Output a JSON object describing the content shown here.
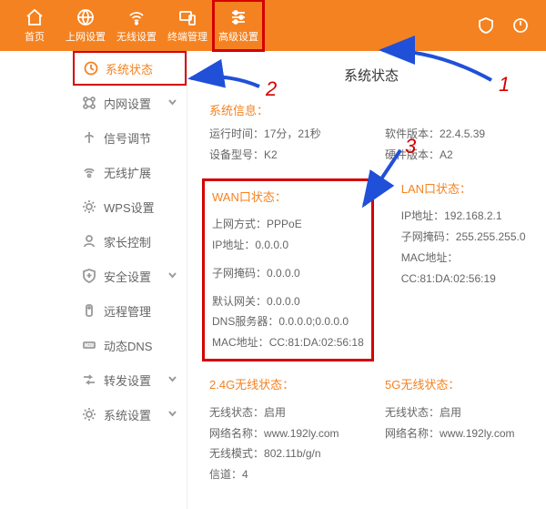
{
  "topnav": {
    "items": [
      {
        "label": "首页"
      },
      {
        "label": "上网设置"
      },
      {
        "label": "无线设置"
      },
      {
        "label": "终端管理"
      },
      {
        "label": "高级设置"
      }
    ]
  },
  "sidebar": {
    "items": [
      {
        "label": "系统状态"
      },
      {
        "label": "内网设置"
      },
      {
        "label": "信号调节"
      },
      {
        "label": "无线扩展"
      },
      {
        "label": "WPS设置"
      },
      {
        "label": "家长控制"
      },
      {
        "label": "安全设置"
      },
      {
        "label": "远程管理"
      },
      {
        "label": "动态DNS"
      },
      {
        "label": "转发设置"
      },
      {
        "label": "系统设置"
      }
    ]
  },
  "page": {
    "title": "系统状态"
  },
  "sysinfo": {
    "head": "系统信息",
    "runtime_k": "运行时间",
    "runtime_v": "17分，21秒",
    "model_k": "设备型号",
    "model_v": "K2",
    "swver_k": "软件版本",
    "swver_v": "22.4.5.39",
    "hwver_k": "硬件版本",
    "hwver_v": "A2"
  },
  "wan": {
    "head": "WAN口状态",
    "mode_k": "上网方式",
    "mode_v": "PPPoE",
    "ip_k": "IP地址",
    "ip_v": "0.0.0.0",
    "mask_k": "子网掩码",
    "mask_v": "0.0.0.0",
    "gw_k": "默认网关",
    "gw_v": "0.0.0.0",
    "dns_k": "DNS服务器",
    "dns_v": "0.0.0.0;0.0.0.0",
    "mac_k": "MAC地址",
    "mac_v": "CC:81:DA:02:56:18"
  },
  "lan": {
    "head": "LAN口状态",
    "ip_k": "IP地址",
    "ip_v": "192.168.2.1",
    "mask_k": "子网掩码",
    "mask_v": "255.255.255.0",
    "mac_k": "MAC地址",
    "mac_v": "CC:81:DA:02:56:19"
  },
  "w24": {
    "head": "2.4G无线状态",
    "state_k": "无线状态",
    "state_v": "启用",
    "ssid_k": "网络名称",
    "ssid_v": "www.192ly.com",
    "mode_k": "无线模式",
    "mode_v": "802.11b/g/n",
    "ch_k": "信道",
    "ch_v": "4"
  },
  "w5": {
    "head": "5G无线状态",
    "state_k": "无线状态",
    "state_v": "启用",
    "ssid_k": "网络名称",
    "ssid_v": "www.192ly.com"
  },
  "ann": {
    "n1": "1",
    "n2": "2",
    "n3": "3"
  }
}
